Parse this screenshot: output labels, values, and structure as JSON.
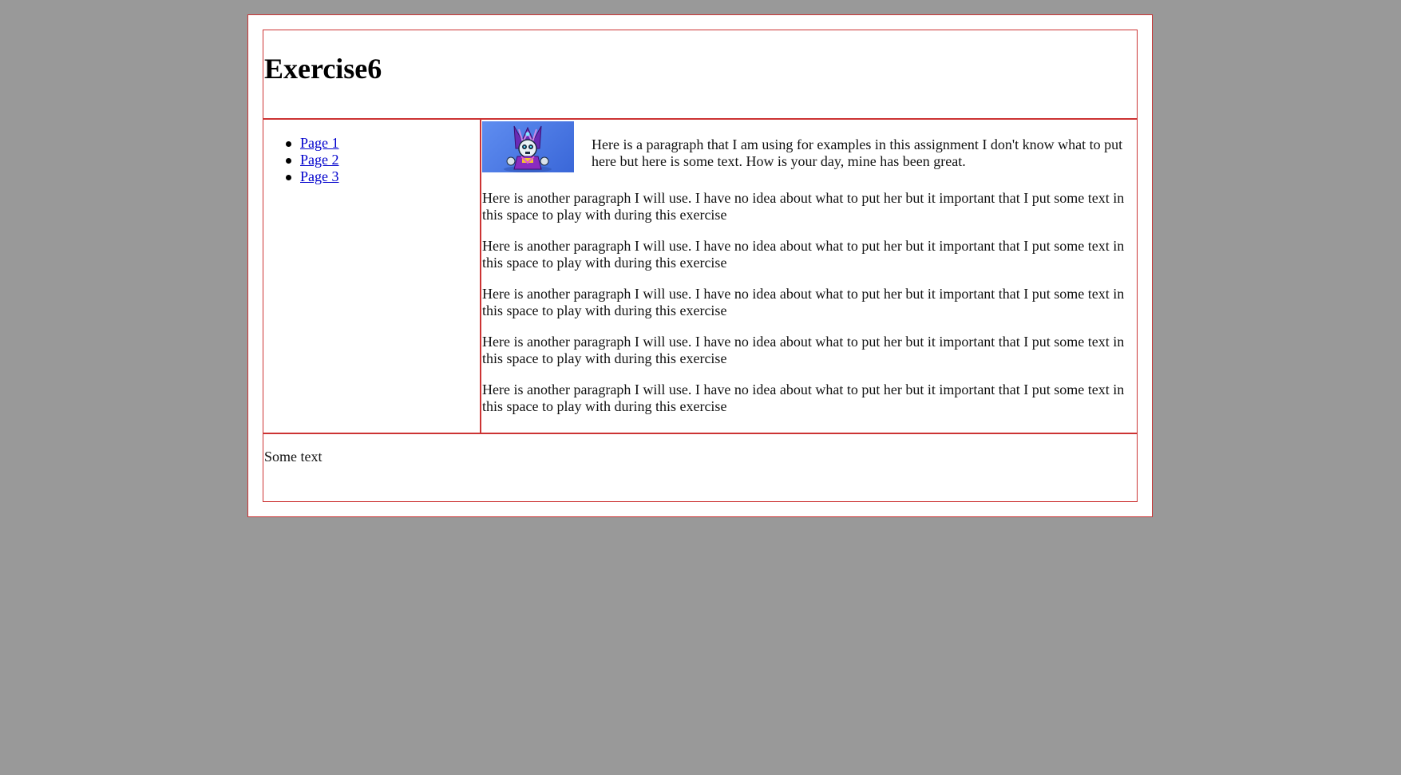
{
  "header": {
    "title": "Exercise6"
  },
  "nav": {
    "items": [
      {
        "label": "Page 1"
      },
      {
        "label": "Page 2"
      },
      {
        "label": "Page 3"
      }
    ]
  },
  "main": {
    "lead_paragraph": "Here is a paragraph that I am using for examples in this assignment I don't know what to put here but here is some text. How is your day, mine has been great.",
    "paragraphs": [
      "Here is another paragraph I will use. I have no idea about what to put her but it important that I put some text in this space to play with during this exercise",
      "Here is another paragraph I will use. I have no idea about what to put her but it important that I put some text in this space to play with during this exercise",
      "Here is another paragraph I will use. I have no idea about what to put her but it important that I put some text in this space to play with during this exercise",
      "Here is another paragraph I will use. I have no idea about what to put her but it important that I put some text in this space to play with during this exercise",
      "Here is another paragraph I will use. I have no idea about what to put her but it important that I put some text in this space to play with during this exercise"
    ],
    "image_icon": "mascot-icon"
  },
  "footer": {
    "text": "Some text"
  },
  "colors": {
    "page_background": "#999999",
    "border": "#cc3333",
    "link": "#0000cc"
  }
}
